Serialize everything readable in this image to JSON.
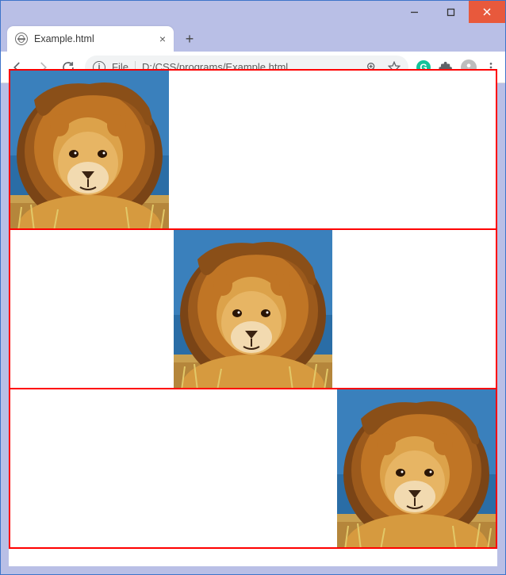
{
  "window": {
    "minimize_label": "Minimize",
    "maximize_label": "Maximize",
    "close_label": "Close"
  },
  "tab": {
    "title": "Example.html",
    "close_label": "Close tab",
    "newtab_label": "New tab"
  },
  "toolbar": {
    "back_label": "Back",
    "forward_label": "Forward",
    "reload_label": "Reload",
    "info_char": "i",
    "file_label": "File",
    "url": "D:/CSS/programs/Example.html",
    "zoom_label": "Zoom",
    "star_label": "Bookmark",
    "ext_grammarly_label": "Grammarly",
    "ext_puzzle_label": "Extensions",
    "profile_label": "Profile",
    "menu_label": "Menu"
  },
  "content": {
    "boxes": [
      {
        "position": "left"
      },
      {
        "position": "center"
      },
      {
        "position": "right"
      }
    ]
  }
}
